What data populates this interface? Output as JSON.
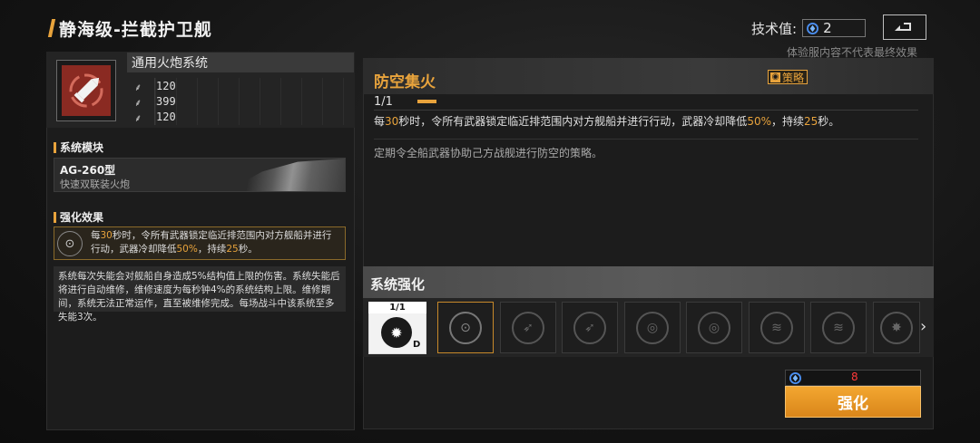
{
  "header": {
    "title": "静海级-拦截护卫舰",
    "tech_label": "技术值:",
    "tech_value": "2",
    "disclaimer": "体验服内容不代表最终效果"
  },
  "weapon": {
    "name": "通用火炮系统",
    "stats": [
      "120",
      "399",
      "120"
    ]
  },
  "module": {
    "section_label": "系统模块",
    "name": "AG-260型",
    "desc": "快速双联装火炮"
  },
  "enhancement_effect": {
    "section_label": "强化效果",
    "line_prefix": "每",
    "seconds": "30",
    "line_mid": "秒时，令所有武器锁定临近排范围内对方舰船并进行行动，武器冷却降低",
    "percent": "50%",
    "line_mid2": "，持续",
    "duration": "25",
    "line_suffix": "秒。",
    "note": "系统每次失能会对舰船自身造成5%结构值上限的伤害。系统失能后将进行自动维修，维修速度为每秒钟4%的系统结构上限。维修期间，系统无法正常运作，直至被维修完成。每场战斗中该系统至多失能3次。"
  },
  "skill": {
    "title": "防空集火",
    "tag": "策略",
    "level": "1/1",
    "desc_prefix": "每",
    "seconds": "30",
    "desc_mid": "秒时，令所有武器锁定临近排范围内对方舰船并进行行动，武器冷却降低",
    "percent": "50%",
    "desc_mid2": "，持续",
    "duration": "25",
    "desc_suffix": "秒。",
    "flavor": "定期令全船武器协助己方战舰进行防空的策略。"
  },
  "system_enhance": {
    "title": "系统强化",
    "first_slot_level": "1/1",
    "first_slot_grade": "D",
    "cost": "8",
    "button_label": "强化"
  }
}
